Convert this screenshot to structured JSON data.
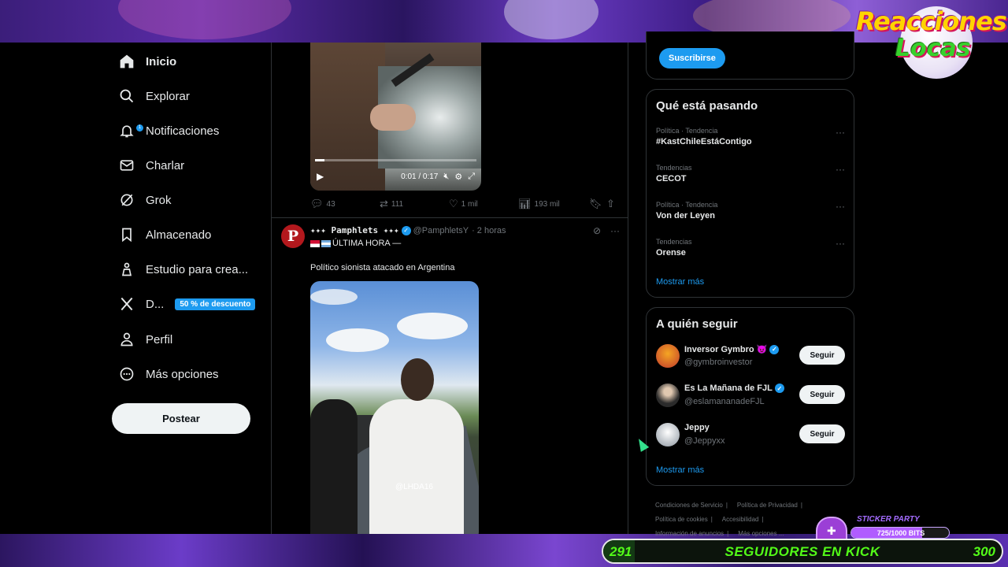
{
  "overlay": {
    "logo_line1": "Reacciones",
    "logo_line2": "Locas"
  },
  "nav": {
    "items": [
      {
        "label": "Inicio",
        "icon": "home-icon",
        "active": true
      },
      {
        "label": "Explorar",
        "icon": "search-icon"
      },
      {
        "label": "Notificaciones",
        "icon": "bell-icon",
        "badge": "1"
      },
      {
        "label": "Charlar",
        "icon": "mail-icon"
      },
      {
        "label": "Grok",
        "icon": "grok-icon"
      },
      {
        "label": "Almacenado",
        "icon": "bookmark-icon"
      },
      {
        "label": "Estudio para crea...",
        "icon": "creator-studio-icon"
      },
      {
        "label": "D...",
        "icon": "x-logo-icon",
        "promo": "50 % de descuento"
      },
      {
        "label": "Perfil",
        "icon": "person-icon"
      },
      {
        "label": "Más opciones",
        "icon": "more-circle-icon"
      }
    ],
    "post_button": "Postear"
  },
  "tweet1": {
    "video_time": "0:01 / 0:17",
    "video_progress": 0.06,
    "replies": "43",
    "reposts": "111",
    "likes": "1 mil",
    "views": "193 mil"
  },
  "tweet2": {
    "avatar_letter": "P",
    "name": "✦✦✦ Pamphlets ✦✦✦",
    "handle": "@PamphletsY",
    "time": "· 2 horas",
    "line1": "ÚLTIMA HORA —",
    "line2": "Político sionista atacado en Argentina",
    "video_watermark": "@LHDA16"
  },
  "sidebar": {
    "subscribe": "Suscribirse",
    "trending_title": "Qué está pasando",
    "trends": [
      {
        "meta": "Política · Tendencia",
        "name": "#KastChileEstáContigo"
      },
      {
        "meta": "Tendencias",
        "name": "CECOT"
      },
      {
        "meta": "Política · Tendencia",
        "name": "Von der Leyen"
      },
      {
        "meta": "Tendencias",
        "name": "Orense"
      }
    ],
    "trends_more": "Mostrar más",
    "follow_title": "A quién seguir",
    "follows": [
      {
        "name": "Inversor Gymbro 😈",
        "handle": "@gymbroinvestor",
        "button": "Seguir",
        "color": "#c0392b"
      },
      {
        "name": "Es La Mañana de FJL",
        "handle": "@eslamananadeFJL",
        "button": "Seguir",
        "color": "#5a5a5a"
      },
      {
        "name": "Jeppy",
        "handle": "@Jeppyxx",
        "button": "Seguir",
        "color": "#9aa3ad"
      }
    ],
    "follow_more": "Mostrar más",
    "footer": [
      "Condiciones de Servicio",
      "Política de Privacidad",
      "Política de cookies",
      "Accesibilidad",
      "Información de anuncios",
      "Más opciones ..."
    ]
  },
  "sticker_party": {
    "title": "STICKER PARTY",
    "progress_text": "725/1000 BITS",
    "progress": 0.725
  },
  "follower_goal": {
    "start": "291",
    "label": "SEGUIDORES EN KICK",
    "end": "300",
    "accent": "#53fc18"
  }
}
